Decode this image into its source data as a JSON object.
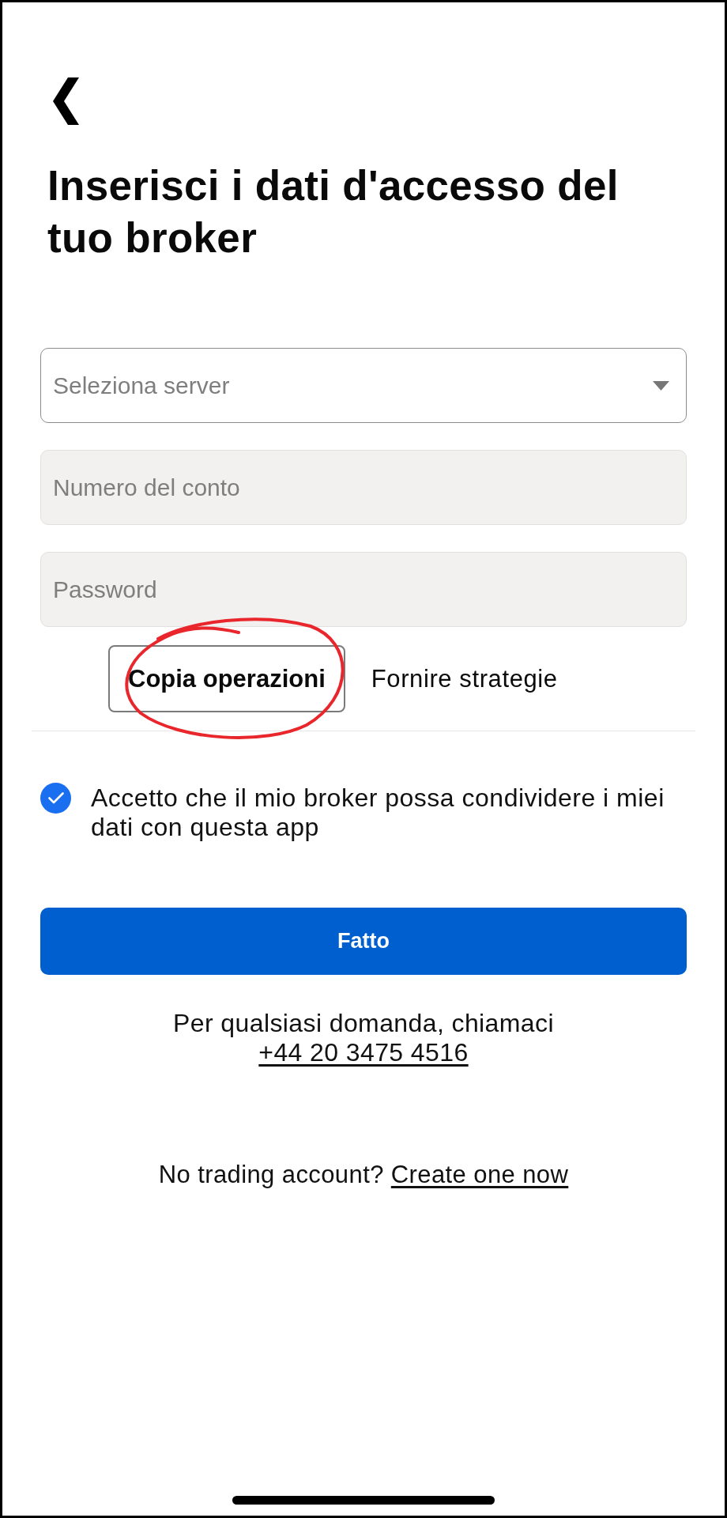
{
  "title": "Inserisci i dati d'accesso del tuo broker",
  "fields": [
    {
      "kind": "select",
      "placeholder": "Seleziona server"
    },
    {
      "kind": "text",
      "placeholder": "Numero del conto"
    },
    {
      "kind": "password",
      "placeholder": "Password"
    }
  ],
  "mode_tabs": [
    {
      "label": "Copia operazioni",
      "selected": true
    },
    {
      "label": "Fornire strategie",
      "selected": false
    }
  ],
  "consent": {
    "checked": true,
    "text": "Accetto che il mio broker possa condividere i miei dati con questa app"
  },
  "submit_button": "Fatto",
  "support": {
    "text": "Per qualsiasi domanda, chiamaci",
    "phone": "+44 20 3475 4516"
  },
  "signup": {
    "text": "No trading account?",
    "link": "Create one now"
  }
}
